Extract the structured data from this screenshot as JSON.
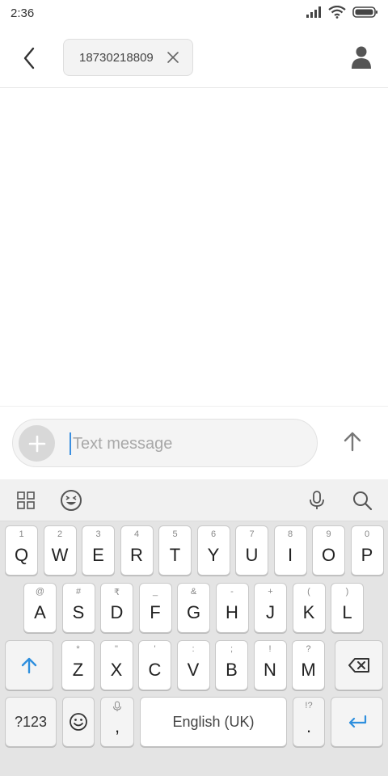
{
  "status_bar": {
    "time": "2:36",
    "icons": [
      "signal-icon",
      "wifi-icon",
      "battery-icon"
    ]
  },
  "header": {
    "back_icon": "chevron-left-icon",
    "recipient": "18730218809",
    "remove_icon": "close-icon",
    "contact_icon": "person-icon"
  },
  "compose": {
    "placeholder": "Text message",
    "attach_icon": "plus-icon",
    "send_icon": "arrow-up-icon"
  },
  "keyboard": {
    "toolbar": [
      "grid-icon",
      "emoji-icon",
      "mic-icon",
      "search-icon"
    ],
    "row1": [
      {
        "hint": "1",
        "label": "Q"
      },
      {
        "hint": "2",
        "label": "W"
      },
      {
        "hint": "3",
        "label": "E"
      },
      {
        "hint": "4",
        "label": "R"
      },
      {
        "hint": "5",
        "label": "T"
      },
      {
        "hint": "6",
        "label": "Y"
      },
      {
        "hint": "7",
        "label": "U"
      },
      {
        "hint": "8",
        "label": "I"
      },
      {
        "hint": "9",
        "label": "O"
      },
      {
        "hint": "0",
        "label": "P"
      }
    ],
    "row2": [
      {
        "hint": "@",
        "label": "A"
      },
      {
        "hint": "#",
        "label": "S"
      },
      {
        "hint": "₹",
        "label": "D"
      },
      {
        "hint": "_",
        "label": "F"
      },
      {
        "hint": "&",
        "label": "G"
      },
      {
        "hint": "-",
        "label": "H"
      },
      {
        "hint": "+",
        "label": "J"
      },
      {
        "hint": "(",
        "label": "K"
      },
      {
        "hint": ")",
        "label": "L"
      }
    ],
    "row3": [
      {
        "hint": "*",
        "label": "Z"
      },
      {
        "hint": "\"",
        "label": "X"
      },
      {
        "hint": "'",
        "label": "C"
      },
      {
        "hint": ":",
        "label": "V"
      },
      {
        "hint": ";",
        "label": "B"
      },
      {
        "hint": "!",
        "label": "N"
      },
      {
        "hint": "?",
        "label": "M"
      }
    ],
    "shift_icon": "shift-arrow-icon",
    "backspace_icon": "backspace-icon",
    "symbols_label": "?123",
    "emoji_key_icon": "smiley-icon",
    "comma_label": ",",
    "space_label": "English (UK)",
    "period_hint": "!?",
    "period_label": ".",
    "enter_icon": "enter-arrow-icon"
  }
}
